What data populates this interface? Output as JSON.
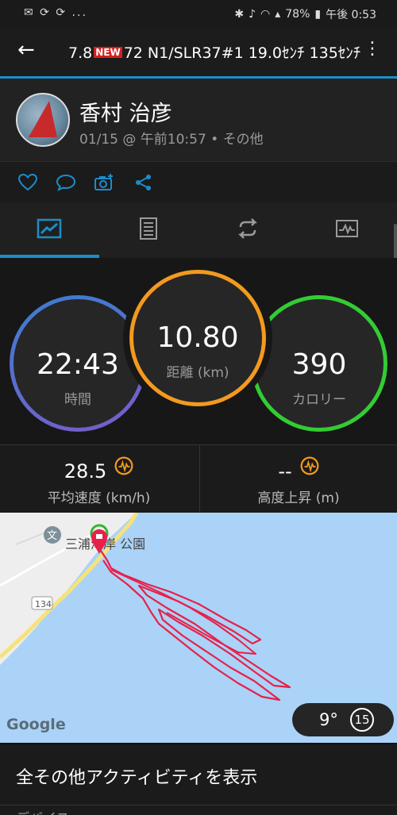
{
  "status_bar": {
    "left_icons": "✉ ⟳ ⟳ ...",
    "battery": "78%",
    "time": "午後 0:53"
  },
  "app_bar": {
    "title_prefix": "7.8",
    "title_badge": "NEW",
    "title_suffix": "72 N1/SLR37#1 19.0ｾﾝﾁ 135ｾﾝﾁ"
  },
  "profile": {
    "name": "香村 治彦",
    "meta": "01/15 @ 午前10:57 • その他"
  },
  "stats": {
    "time_value": "22:43",
    "time_label": "時間",
    "distance_value": "10.80",
    "distance_label": "距離 (km)",
    "calories_value": "390",
    "calories_label": "カロリー"
  },
  "metrics": {
    "avg_speed_value": "28.5",
    "avg_speed_label": "平均速度 (km/h)",
    "elevation_value": "--",
    "elevation_label": "高度上昇 (m)"
  },
  "map": {
    "place_label": "三浦海岸 公園",
    "road_number": "134",
    "google_logo": "Google",
    "temperature": "9°",
    "wind_speed": "15"
  },
  "all_activities": "全その他アクティビティを表示",
  "device_label": "デバイス",
  "colors": {
    "accent_blue": "#1c8dc9",
    "distance_orange": "#f39a1e",
    "calorie_green": "#33cc33",
    "track_red": "#e8204a"
  }
}
